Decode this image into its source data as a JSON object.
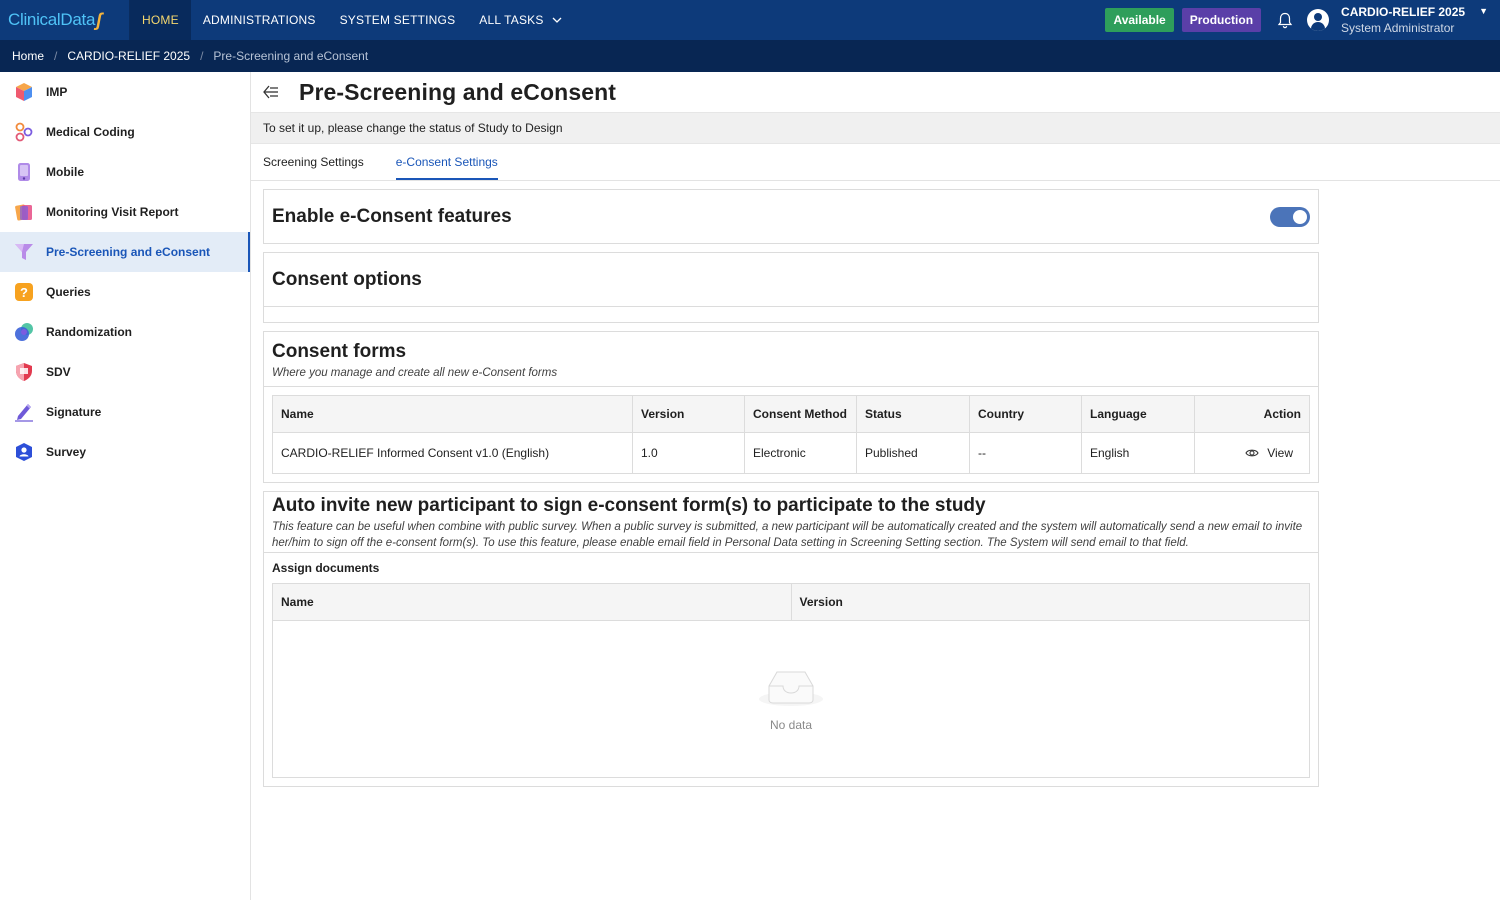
{
  "topbar": {
    "logo_text": "ClinicalData",
    "nav": [
      {
        "label": "HOME",
        "active": true
      },
      {
        "label": "ADMINISTRATIONS",
        "active": false
      },
      {
        "label": "SYSTEM SETTINGS",
        "active": false
      },
      {
        "label": "ALL TASKS",
        "active": false,
        "has_dropdown": true
      }
    ],
    "badges": {
      "available": "Available",
      "production": "Production"
    },
    "user": {
      "study": "CARDIO-RELIEF 2025",
      "role": "System Administrator"
    },
    "colors": {
      "bar": "#0d3a7a",
      "active_nav_text": "#f5d76e",
      "available": "#2e9e5b",
      "production": "#5a3fa8"
    }
  },
  "breadcrumb": [
    "Home",
    "CARDIO-RELIEF 2025",
    "Pre-Screening and eConsent"
  ],
  "sidebar": {
    "items": [
      {
        "label": "IMP",
        "icon": "cube-icon"
      },
      {
        "label": "Medical Coding",
        "icon": "coding-icon"
      },
      {
        "label": "Mobile",
        "icon": "mobile-icon"
      },
      {
        "label": "Monitoring Visit Report",
        "icon": "report-icon"
      },
      {
        "label": "Pre-Screening and eConsent",
        "icon": "funnel-icon",
        "active": true
      },
      {
        "label": "Queries",
        "icon": "question-icon"
      },
      {
        "label": "Randomization",
        "icon": "randomization-icon"
      },
      {
        "label": "SDV",
        "icon": "shield-icon"
      },
      {
        "label": "Signature",
        "icon": "pen-icon"
      },
      {
        "label": "Survey",
        "icon": "survey-icon"
      }
    ]
  },
  "page": {
    "title": "Pre-Screening and eConsent",
    "notice": "To set it up, please change the status of Study to Design",
    "tabs": [
      {
        "label": "Screening Settings",
        "active": false
      },
      {
        "label": "e-Consent Settings",
        "active": true
      }
    ]
  },
  "enable_section": {
    "title": "Enable e-Consent features",
    "enabled": true
  },
  "consent_options": {
    "title": "Consent options"
  },
  "consent_forms": {
    "title": "Consent forms",
    "subtitle": "Where you manage and create all new e-Consent forms",
    "columns": [
      "Name",
      "Version",
      "Consent Method",
      "Status",
      "Country",
      "Language",
      "Action"
    ],
    "rows": [
      {
        "name": "CARDIO-RELIEF Informed Consent v1.0 (English)",
        "version": "1.0",
        "method": "Electronic",
        "status": "Published",
        "country": "--",
        "language": "English",
        "action": "View"
      }
    ]
  },
  "auto_invite": {
    "title": "Auto invite new participant to sign e-consent form(s) to participate to the study",
    "description": "This feature can be useful when combine with public survey. When a public survey is submitted, a new participant will be automatically created and the system will automatically send a new email to invite her/him to sign off the e-consent form(s). To use this feature, please enable email field in Personal Data setting in Screening Setting section. The System will send email to that field.",
    "assign_label": "Assign documents",
    "columns": [
      "Name",
      "Version"
    ],
    "empty_text": "No data"
  }
}
